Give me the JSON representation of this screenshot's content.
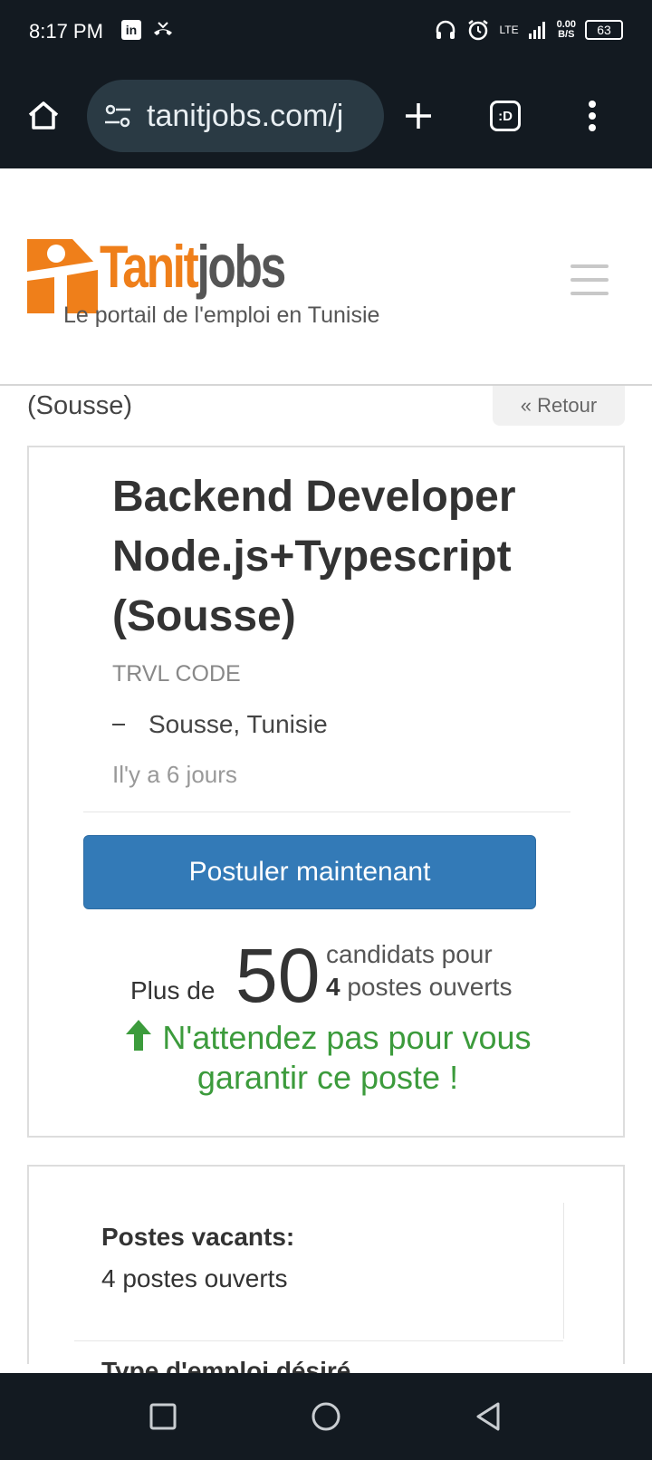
{
  "status_bar": {
    "time": "8:17 PM",
    "network": "LTE",
    "speed": "0.00",
    "speed_unit": "B/S",
    "battery": "63",
    "linkedin_icon_text": "in"
  },
  "browser": {
    "url": "tanitjobs.com/j",
    "tab_count": ":D"
  },
  "site": {
    "logo_tanit": "Tanit",
    "logo_jobs": "jobs",
    "tagline": "Le portail de l'emploi en Tunisie"
  },
  "page": {
    "breadcrumb_city": "(Sousse)",
    "back_label": "« Retour"
  },
  "job": {
    "title": "Backend Developer Node.js+Typescript (Sousse)",
    "company": "TRVL CODE",
    "location": "Sousse, Tunisie",
    "posted": "Il'y a 6 jours",
    "apply_label": "Postuler maintenant",
    "stats": {
      "prefix": "Plus de",
      "candidates": "50",
      "candidates_label": "candidats pour",
      "openings": "4",
      "openings_label": "postes ouverts"
    },
    "urgency": "N'attendez pas pour vous garantir ce poste !"
  },
  "details": {
    "vacancies_label": "Postes vacants:",
    "vacancies_value": "4 postes ouverts",
    "next_label_cut": "Type d'emploi désiré"
  },
  "colors": {
    "orange": "#ef7f1a",
    "primary": "#337ab7",
    "success": "#3c9b3c",
    "dark_bar": "#131a21"
  }
}
